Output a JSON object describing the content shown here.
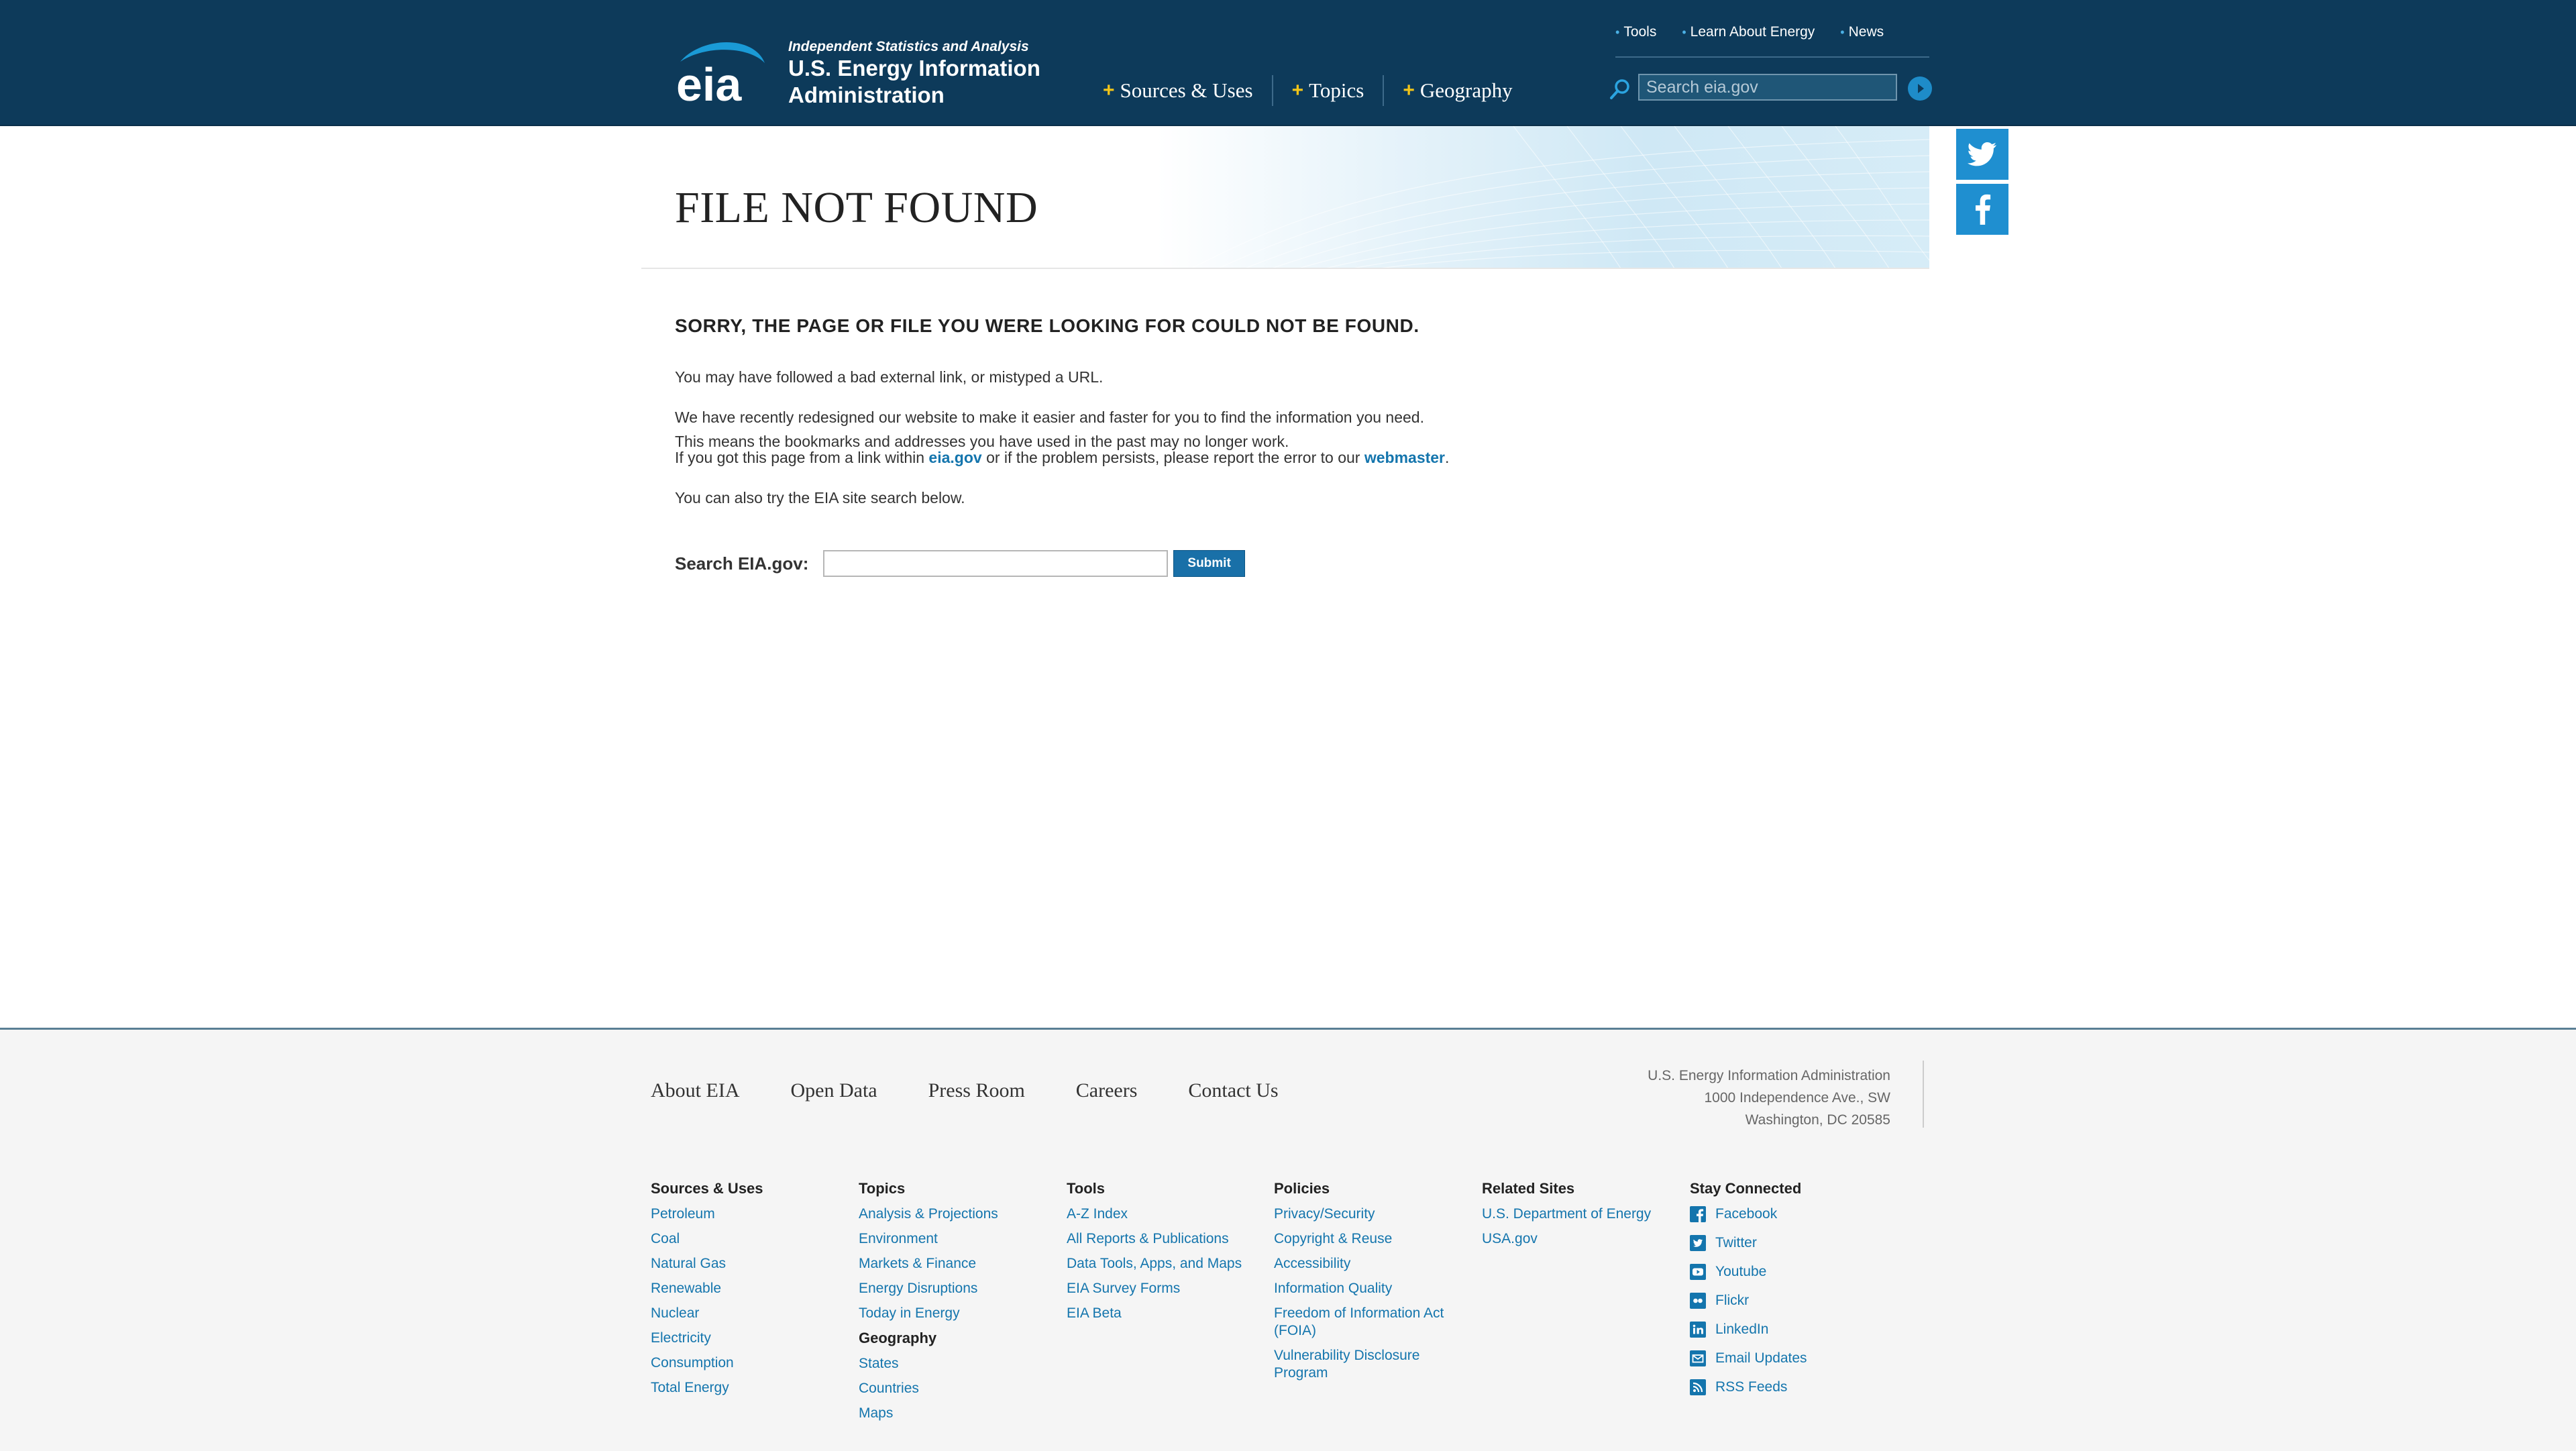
{
  "header": {
    "tagline": "Independent Statistics and Analysis",
    "agency_line1": "U.S. Energy Information",
    "agency_line2": "Administration",
    "main_nav": [
      {
        "label": "Sources & Uses"
      },
      {
        "label": "Topics"
      },
      {
        "label": "Geography"
      }
    ],
    "util_nav": [
      {
        "label": "Tools"
      },
      {
        "label": "Learn About Energy"
      },
      {
        "label": "News"
      }
    ],
    "search_placeholder": "Search eia.gov"
  },
  "banner": {
    "title": "FILE NOT FOUND"
  },
  "content": {
    "subhead": "SORRY, THE PAGE OR FILE YOU WERE LOOKING FOR COULD NOT BE FOUND.",
    "p1": "You may have followed a bad external link, or mistyped a URL.",
    "p2_line1": "We have recently redesigned our website to make it easier and faster for you to find the information you need.",
    "p2_line2": "This means the bookmarks and addresses you have used in the past may no longer work.",
    "p3_before": "If you got this page from a link within ",
    "p3_link1": "eia.gov",
    "p3_middle": " or if the problem persists, please report the error to our ",
    "p3_link2": "webmaster",
    "p3_after": ".",
    "p4": "You can also try the EIA site search below.",
    "search_label": "Search EIA.gov:",
    "search_value": "",
    "submit_label": "Submit"
  },
  "footer": {
    "top_nav": [
      {
        "label": "About EIA"
      },
      {
        "label": "Open Data"
      },
      {
        "label": "Press Room"
      },
      {
        "label": "Careers"
      },
      {
        "label": "Contact Us"
      }
    ],
    "address": {
      "line1": "U.S. Energy Information Administration",
      "line2": "1000 Independence Ave., SW",
      "line3": "Washington, DC 20585"
    },
    "sources_uses": {
      "heading": "Sources & Uses",
      "links": [
        "Petroleum",
        "Coal",
        "Natural Gas",
        "Renewable",
        "Nuclear",
        "Electricity",
        "Consumption",
        "Total Energy"
      ]
    },
    "topics": {
      "heading": "Topics",
      "links": [
        "Analysis & Projections",
        "Environment",
        "Markets & Finance",
        "Energy Disruptions",
        "Today in Energy"
      ],
      "geography_heading": "Geography",
      "geography_links": [
        "States",
        "Countries",
        "Maps"
      ]
    },
    "tools": {
      "heading": "Tools",
      "links": [
        "A-Z Index",
        "All Reports & Publications",
        "Data Tools, Apps, and Maps",
        "EIA Survey Forms",
        "EIA Beta"
      ]
    },
    "policies": {
      "heading": "Policies",
      "links": [
        "Privacy/Security",
        "Copyright & Reuse",
        "Accessibility",
        "Information Quality",
        "Freedom of Information Act (FOIA)",
        "Vulnerability Disclosure Program"
      ]
    },
    "related": {
      "heading": "Related Sites",
      "links": [
        "U.S. Department of Energy",
        "USA.gov"
      ]
    },
    "stay_connected": {
      "heading": "Stay Connected",
      "items": [
        {
          "label": "Facebook",
          "icon": "facebook-icon"
        },
        {
          "label": "Twitter",
          "icon": "twitter-icon"
        },
        {
          "label": "Youtube",
          "icon": "youtube-icon"
        },
        {
          "label": "Flickr",
          "icon": "flickr-icon"
        },
        {
          "label": "LinkedIn",
          "icon": "linkedin-icon"
        },
        {
          "label": "Email Updates",
          "icon": "email-icon"
        },
        {
          "label": "RSS Feeds",
          "icon": "rss-icon"
        }
      ]
    }
  },
  "colors": {
    "header_bg": "#0d3a5a",
    "accent_plus": "#f2c418",
    "link": "#1475ad",
    "social_button": "#1f8fd0",
    "submit_button": "#1970a8",
    "footer_bg": "#f5f5f5"
  }
}
